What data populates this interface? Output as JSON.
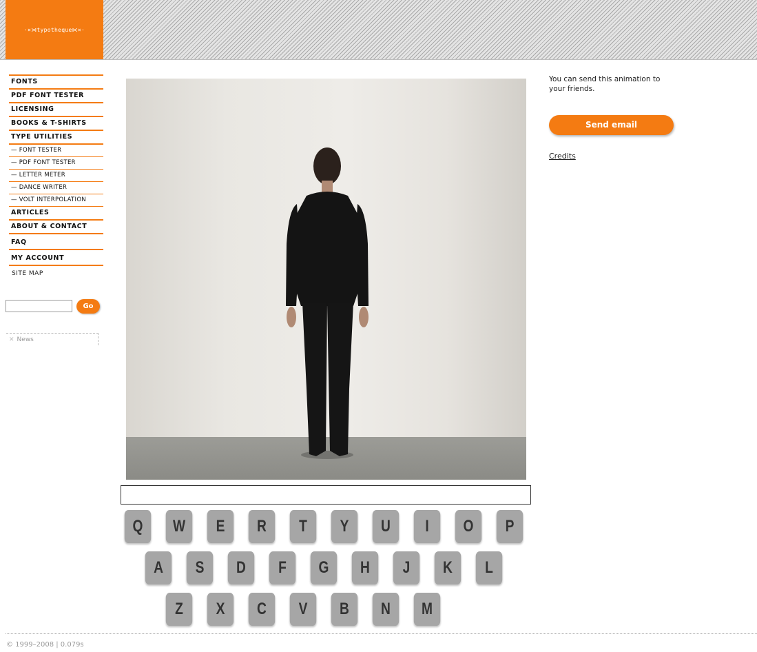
{
  "header": {
    "logo_text": "·×⋊typotheque⋉×·",
    "accent_color": "#f47b12"
  },
  "nav": {
    "items": [
      {
        "label": "FONTS"
      },
      {
        "label": "PDF FONT TESTER"
      },
      {
        "label": "LICENSING"
      },
      {
        "label": "BOOKS & T-SHIRTS"
      },
      {
        "label": "TYPE UTILITIES"
      },
      {
        "label": "— FONT TESTER"
      },
      {
        "label": "— PDF FONT TESTER"
      },
      {
        "label": "— LETTER METER"
      },
      {
        "label": "— DANCE WRITER"
      },
      {
        "label": "— VOLT INTERPOLATION"
      },
      {
        "label": "ARTICLES"
      },
      {
        "label": "ABOUT & CONTACT"
      },
      {
        "label": "FAQ"
      },
      {
        "label": "MY ACCOUNT"
      }
    ],
    "site_map": "SITE MAP"
  },
  "search": {
    "value": "",
    "go_label": "Go"
  },
  "news": {
    "label": "News",
    "icon": "x-icon"
  },
  "main": {
    "text_field_value": "",
    "keyboard_rows": [
      [
        "Q",
        "W",
        "E",
        "R",
        "T",
        "Y",
        "U",
        "I",
        "O",
        "P"
      ],
      [
        "A",
        "S",
        "D",
        "F",
        "G",
        "H",
        "J",
        "K",
        "L"
      ],
      [
        "Z",
        "X",
        "C",
        "V",
        "B",
        "N",
        "M"
      ]
    ]
  },
  "right": {
    "share_text": "You can send this animation to your friends.",
    "send_label": "Send email",
    "credits_label": "Credits"
  },
  "footer": {
    "text": "© 1999–2008 | 0.079s"
  }
}
